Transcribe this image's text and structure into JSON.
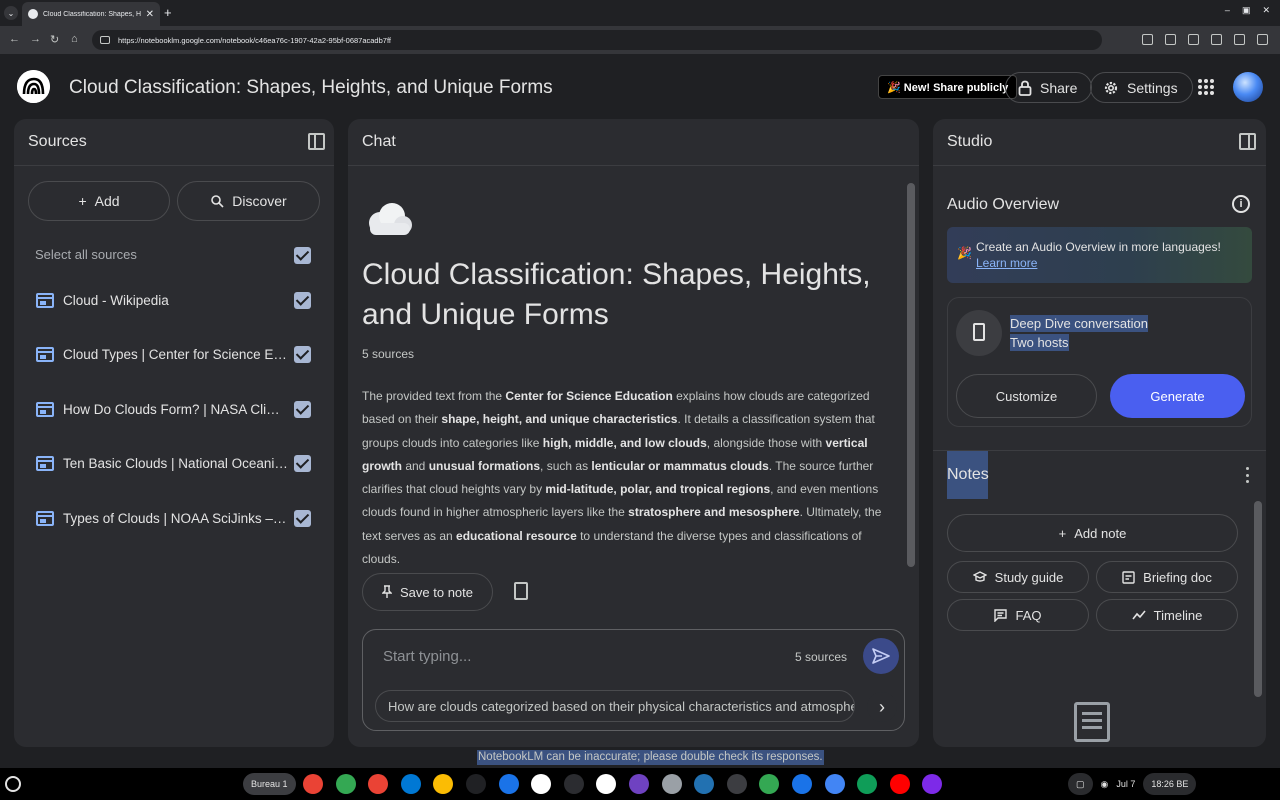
{
  "browser": {
    "tab_title": "Cloud Classification: Shapes, He",
    "tab_close": "✕",
    "new_tab": "+",
    "url": "https://notebooklm.google.com/notebook/c46ea76c-1907-42a2-95bf-0687acadb7ff",
    "window_controls": [
      "–",
      "▣",
      "✕"
    ]
  },
  "header": {
    "title": "Cloud Classification: Shapes, Heights, and Unique Forms",
    "share_publicly": "🎉 New! Share publicly",
    "share": "Share",
    "settings": "Settings"
  },
  "sources": {
    "title": "Sources",
    "add": "Add",
    "discover": "Discover",
    "select_all": "Select all sources",
    "items": [
      {
        "label": "Cloud - Wikipedia"
      },
      {
        "label": "Cloud Types | Center for Science Education"
      },
      {
        "label": "How Do Clouds Form? | NASA Climate Kids"
      },
      {
        "label": "Ten Basic Clouds | National Oceanic and Atmospheric Administration"
      },
      {
        "label": "Types of Clouds | NOAA SciJinks – All About Weather"
      }
    ]
  },
  "chat": {
    "title": "Chat",
    "notebook_title": "Cloud Classification: Shapes, Heights, and Unique Forms",
    "source_count": "5 sources",
    "summary": [
      {
        "t": "The provided text from the ",
        "b": false
      },
      {
        "t": "Center for Science Education",
        "b": true
      },
      {
        "t": " explains how clouds are categorized based on their ",
        "b": false
      },
      {
        "t": "shape, height, and unique characteristics",
        "b": true
      },
      {
        "t": ". It details a classification system that groups clouds into categories like ",
        "b": false
      },
      {
        "t": "high, middle, and low clouds",
        "b": true
      },
      {
        "t": ", alongside those with ",
        "b": false
      },
      {
        "t": "vertical growth",
        "b": true
      },
      {
        "t": " and ",
        "b": false
      },
      {
        "t": "unusual formations",
        "b": true
      },
      {
        "t": ", such as ",
        "b": false
      },
      {
        "t": "lenticular or mammatus clouds",
        "b": true
      },
      {
        "t": ". The source further clarifies that cloud heights vary by ",
        "b": false
      },
      {
        "t": "mid-latitude, polar, and tropical regions",
        "b": true
      },
      {
        "t": ", and even mentions clouds found in higher atmospheric layers like the ",
        "b": false
      },
      {
        "t": "stratosphere and mesosphere",
        "b": true
      },
      {
        "t": ". Ultimately, the text serves as an ",
        "b": false
      },
      {
        "t": "educational resource",
        "b": true
      },
      {
        "t": " to understand the diverse types and classifications of clouds.",
        "b": false
      }
    ],
    "save_to_note": "Save to note",
    "input_placeholder": "Start typing...",
    "input_source_count": "5 sources",
    "suggestion": "How are clouds categorized based on their physical characteristics and atmospheric lo"
  },
  "studio": {
    "title": "Studio",
    "audio_overview": "Audio Overview",
    "banner_text": "Create an Audio Overview in more languages! ",
    "banner_link": "Learn more",
    "deep_dive_title": "Deep Dive conversation",
    "deep_dive_sub": "Two hosts",
    "customize": "Customize",
    "generate": "Generate",
    "notes": "Notes",
    "add_note": "Add note",
    "study_guide": "Study guide",
    "briefing_doc": "Briefing doc",
    "faq": "FAQ",
    "timeline": "Timeline"
  },
  "disclaimer": "NotebookLM can be inaccurate; please double check its responses.",
  "taskbar": {
    "desk": "Bureau 1",
    "date": "Jul 7",
    "time": "18:26 BE",
    "apps": [
      "chrome-icon",
      "drive-icon",
      "gmail-icon",
      "vscode-icon",
      "photos-icon",
      "notebooklm-icon",
      "app-icon",
      "gemini-icon",
      "anthropic-icon",
      "chatgpt-icon",
      "app-icon-2",
      "app-icon-3",
      "wordpress-icon",
      "terminal-icon",
      "code-icon",
      "files-icon",
      "docs-icon",
      "sheets-icon",
      "youtube-icon",
      "canva-icon"
    ],
    "app_colors": [
      "#ea4335",
      "#34a853",
      "#ea4335",
      "#0078d4",
      "#fbbc04",
      "#202124",
      "#1a73e8",
      "#ffffff",
      "#2b2c30",
      "#ffffff",
      "#6f42c1",
      "#9aa0a6",
      "#2271b1",
      "#3c3d41",
      "#34a853",
      "#1a73e8",
      "#4285f4",
      "#0f9d58",
      "#ff0000",
      "#7d2ae8"
    ]
  }
}
